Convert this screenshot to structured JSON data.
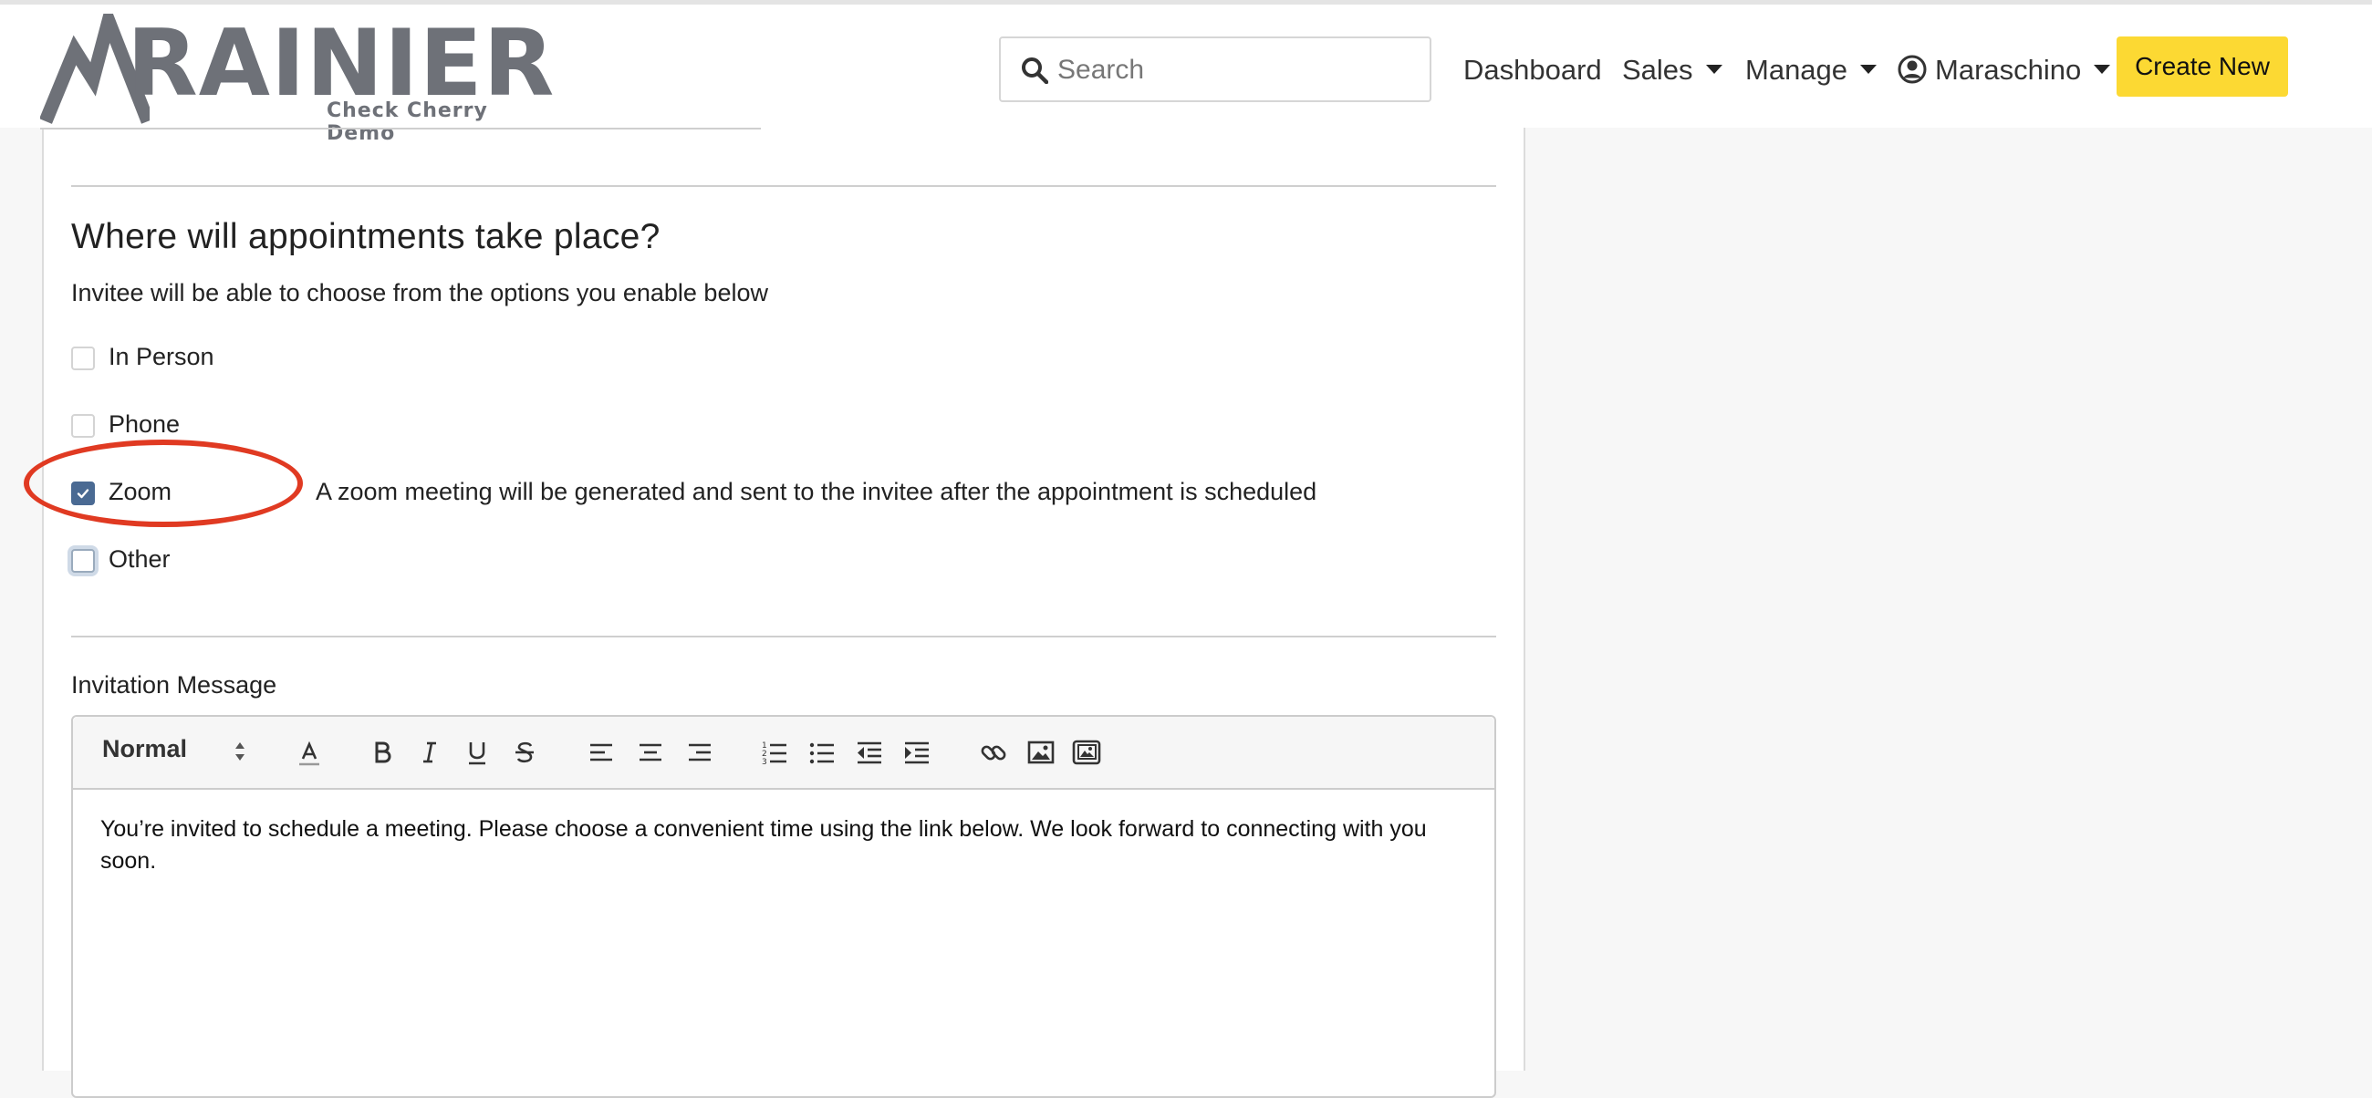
{
  "header": {
    "logo_text": "RAINIER",
    "logo_subtitle": "Check Cherry Demo",
    "search": {
      "placeholder": "Search",
      "value": ""
    },
    "nav": {
      "dashboard": "Dashboard",
      "sales": "Sales",
      "manage": "Manage",
      "user": "Maraschino"
    },
    "create_new": "Create New"
  },
  "location_section": {
    "title": "Where will appointments take place?",
    "subtitle": "Invitee will be able to choose from the options you enable below",
    "options": [
      {
        "label": "In Person",
        "checked": false
      },
      {
        "label": "Phone",
        "checked": false
      },
      {
        "label": "Zoom",
        "checked": true
      },
      {
        "label": "Other",
        "checked": false
      }
    ],
    "zoom_note": "A zoom meeting will be generated and sent to the invitee after the appointment is scheduled"
  },
  "invitation": {
    "label": "Invitation Message",
    "format_select": "Normal",
    "body": "You’re invited to schedule a meeting. Please choose a convenient time using the link below. We look forward to connecting with you soon."
  },
  "colors": {
    "accent_yellow": "#fcd933",
    "checkbox_checked": "#4a6a93",
    "annotation_red": "#e03a22",
    "logo_gray": "#6e7178"
  }
}
